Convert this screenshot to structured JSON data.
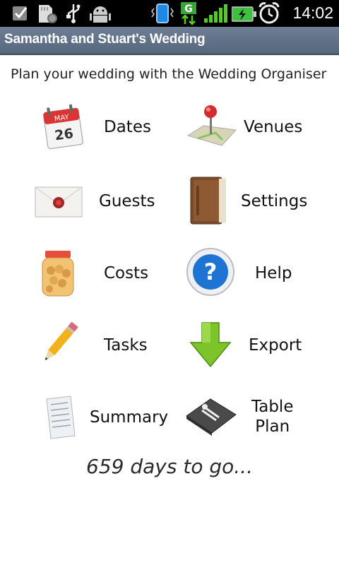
{
  "status_bar": {
    "time": "14:02",
    "network_type": "G",
    "icons": [
      "checkbox-icon",
      "sd-card-icon",
      "usb-icon",
      "android-debug-icon",
      "vibrate-icon",
      "network-g-icon",
      "signal-icon",
      "battery-charging-icon",
      "alarm-icon"
    ]
  },
  "app": {
    "title": "Samantha and Stuart's Wedding"
  },
  "intro": "Plan your wedding with the Wedding Organiser",
  "menu": {
    "dates": "Dates",
    "venues": "Venues",
    "guests": "Guests",
    "settings": "Settings",
    "costs": "Costs",
    "help": "Help",
    "tasks": "Tasks",
    "export": "Export",
    "summary": "Summary",
    "table_plan_line1": "Table",
    "table_plan_line2": "Plan"
  },
  "calendar_icon": {
    "month": "MAY",
    "day": "26"
  },
  "countdown": "659 days to go..."
}
